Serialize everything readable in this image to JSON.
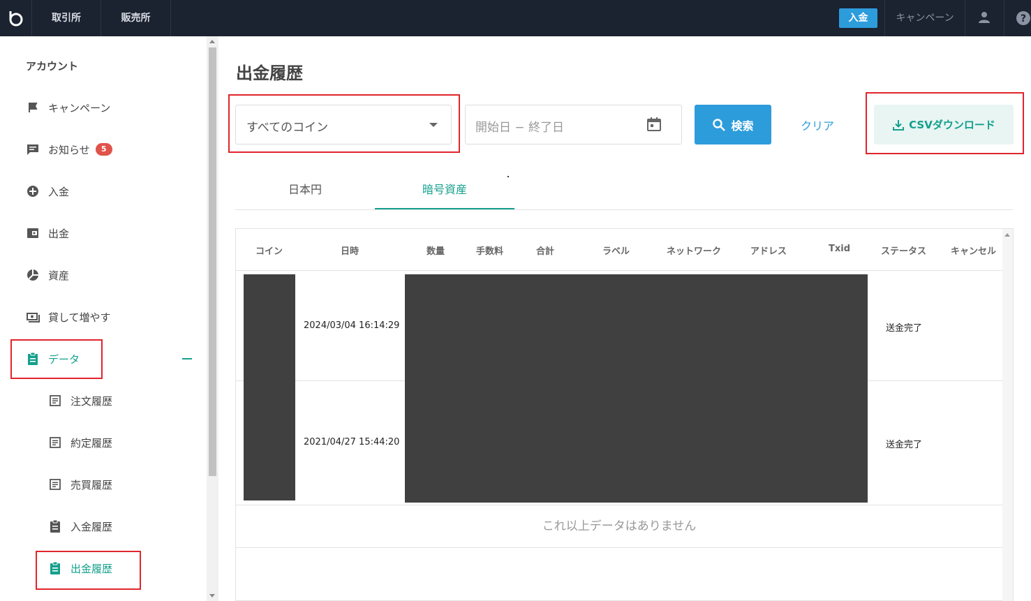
{
  "header": {
    "nav": [
      "取引所",
      "販売所"
    ],
    "deposit_label": "入金",
    "campaign_label": "キャンペーン"
  },
  "sidebar": {
    "title": "アカウント",
    "items": [
      {
        "label": "キャンペーン",
        "icon": "flag-icon"
      },
      {
        "label": "お知らせ",
        "icon": "message-icon",
        "badge": "5"
      },
      {
        "label": "入金",
        "icon": "plus-circle-icon"
      },
      {
        "label": "出金",
        "icon": "wallet-icon"
      },
      {
        "label": "資産",
        "icon": "pie-chart-icon"
      },
      {
        "label": "貸して増やす",
        "icon": "cash-icon"
      },
      {
        "label": "データ",
        "icon": "clipboard-icon"
      }
    ],
    "sub_items": [
      {
        "label": "注文履歴",
        "icon": "document-icon"
      },
      {
        "label": "約定履歴",
        "icon": "document-icon"
      },
      {
        "label": "売買履歴",
        "icon": "document-icon"
      },
      {
        "label": "入金履歴",
        "icon": "clipboard-icon"
      },
      {
        "label": "出金履歴",
        "icon": "clipboard-icon"
      }
    ]
  },
  "main": {
    "title": "出金履歴",
    "coin_select": "すべてのコイン",
    "date_placeholder": "開始日 − 終了日",
    "search_label": "検索",
    "clear_label": "クリア",
    "csv_label": "CSVダウンロード",
    "tabs": [
      "日本円",
      "暗号資産"
    ],
    "table": {
      "headers": [
        "コイン",
        "日時",
        "数量",
        "手数料",
        "合計",
        "ラベル",
        "ネットワーク",
        "アドレス",
        "Txid",
        "ステータス",
        "キャンセル"
      ],
      "rows": [
        {
          "datetime": "2024/03/04 16:14:29",
          "status": "送金完了"
        },
        {
          "datetime": "2021/04/27 15:44:20",
          "status": "送金完了"
        }
      ],
      "footer": "これ以上データはありません"
    }
  },
  "colors": {
    "accent": "#14a08c",
    "primary": "#2d9cdb",
    "header_bg": "#1b2230",
    "highlight": "#e0252b"
  }
}
